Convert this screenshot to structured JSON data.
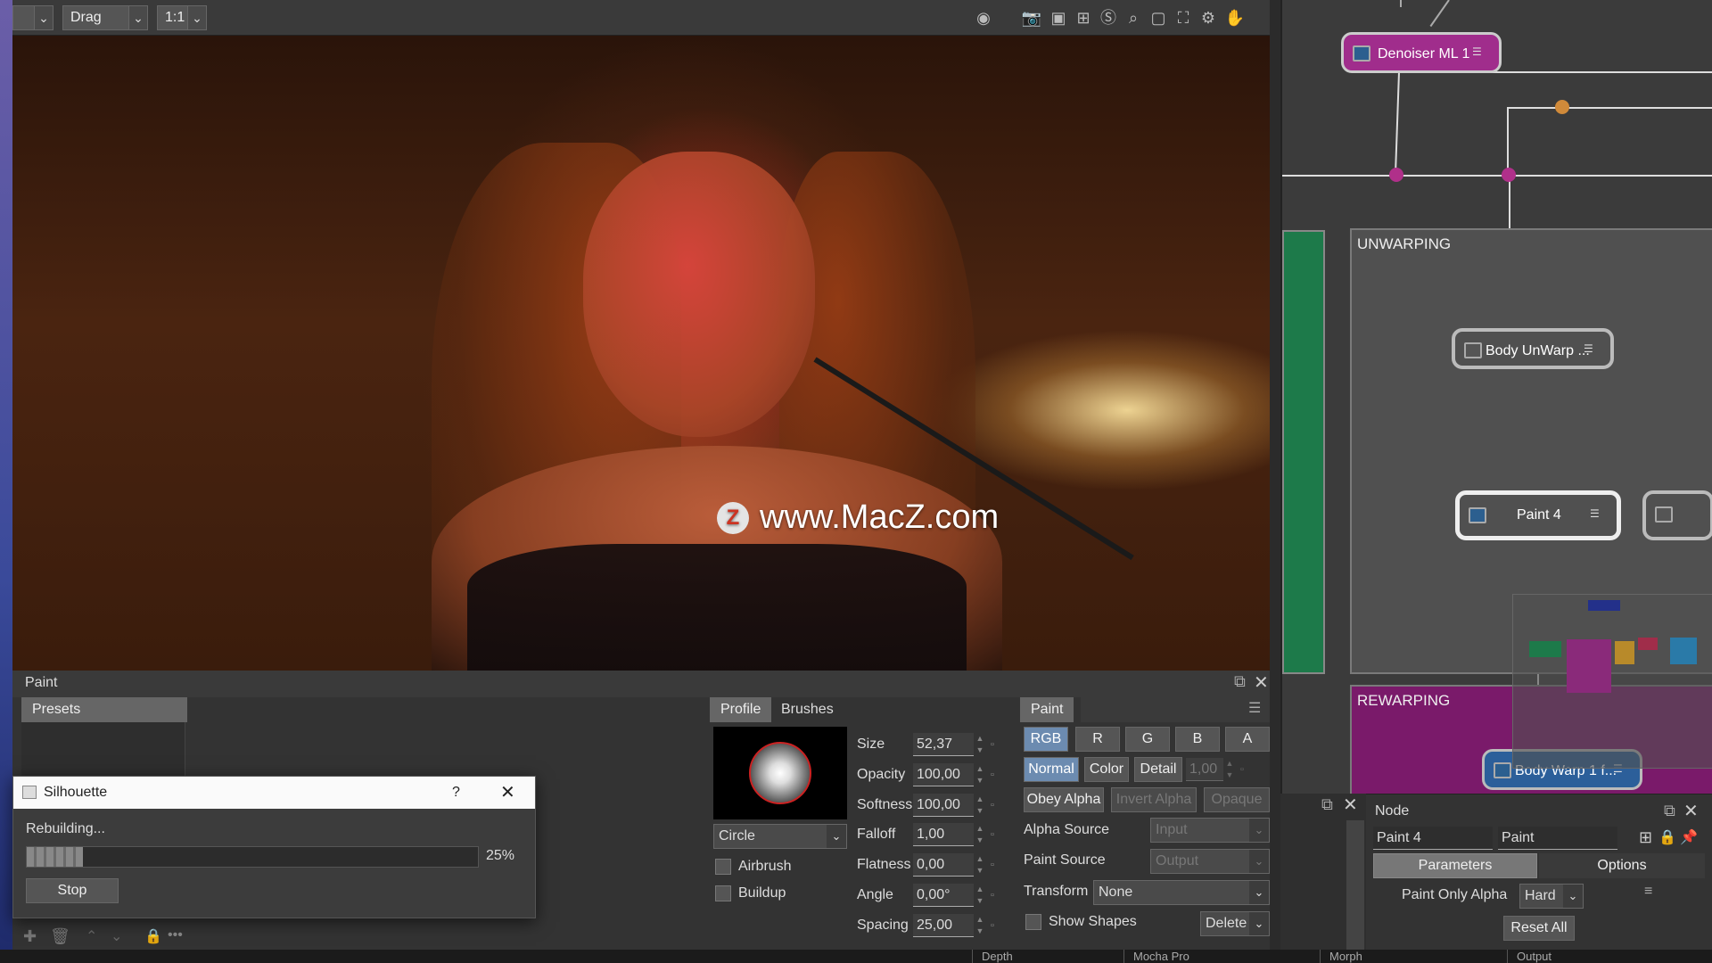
{
  "toolbar": {
    "mode": "Drag",
    "zoom": "1:1"
  },
  "viewer": {
    "watermark": "www.MacZ.com",
    "watermark_logo": "Z"
  },
  "paint_panel": {
    "title": "Paint",
    "presets_tab": "Presets",
    "profile_tab": "Profile",
    "brushes_tab": "Brushes",
    "brush_shape": "Circle",
    "airbrush": "Airbrush",
    "buildup": "Buildup",
    "params": [
      {
        "label": "Size",
        "value": "52,37"
      },
      {
        "label": "Opacity",
        "value": "100,00"
      },
      {
        "label": "Softness",
        "value": "100,00"
      },
      {
        "label": "Falloff",
        "value": "1,00"
      },
      {
        "label": "Flatness",
        "value": "0,00"
      },
      {
        "label": "Angle",
        "value": "0,00°"
      },
      {
        "label": "Spacing",
        "value": "25,00"
      }
    ],
    "paint_section": "Paint",
    "channels": [
      "RGB",
      "R",
      "G",
      "B",
      "A"
    ],
    "modes": [
      "Normal",
      "Color",
      "Detail"
    ],
    "mode_value": "1,00",
    "alpha_buttons": [
      "Obey Alpha",
      "Invert Alpha",
      "Opaque"
    ],
    "alpha_source_label": "Alpha Source",
    "alpha_source_value": "Input",
    "paint_source_label": "Paint Source",
    "paint_source_value": "Output",
    "transform_label": "Transform",
    "transform_value": "None",
    "show_shapes": "Show Shapes",
    "delete": "Delete"
  },
  "dialog": {
    "title": "Silhouette",
    "help": "?",
    "status": "Rebuilding...",
    "progress": 0.25,
    "progress_text": "25%",
    "stop": "Stop"
  },
  "node_graph": {
    "nodes": [
      "Denoiser ML 1",
      "Body UnWarp ...",
      "Paint 4",
      "Body Warp 1 f..."
    ],
    "groups": [
      "UNWARPING",
      "REWARPING"
    ]
  },
  "node_panel": {
    "title": "Node",
    "node_name": "Paint 4",
    "node_type": "Paint",
    "tab_parameters": "Parameters",
    "tab_options": "Options",
    "paint_only_alpha_label": "Paint Only Alpha",
    "paint_only_alpha_value": "Hard",
    "reset_all": "Reset All"
  },
  "bottom_tabs": [
    "Depth",
    "Mocha Pro",
    "Morph",
    "Output"
  ]
}
